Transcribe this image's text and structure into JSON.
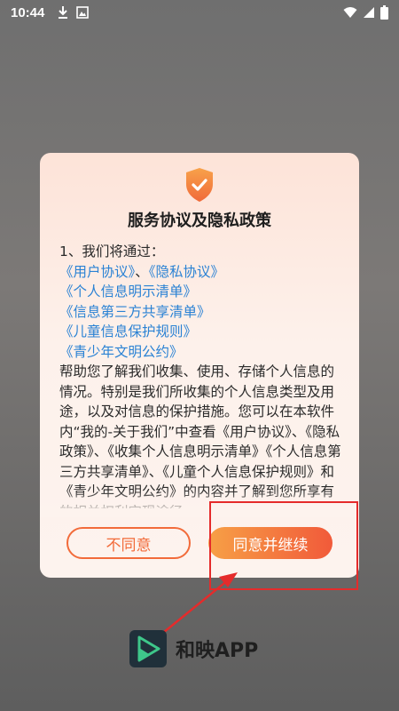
{
  "status_bar": {
    "time": "10:44",
    "left_icons": [
      "download-icon",
      "image-icon"
    ],
    "right_icons": [
      "wifi-icon",
      "signal-icon",
      "battery-icon"
    ]
  },
  "dialog": {
    "title": "服务协议及隐私政策",
    "intro": "1、我们将通过：",
    "links": {
      "user_agreement": "《用户协议》",
      "separator": "、",
      "privacy_agreement": "《隐私协议》",
      "personal_info_list": "《个人信息明示清单》",
      "third_party_list": "《信息第三方共享清单》",
      "child_protection": "《儿童信息保护规则》",
      "youth_pact": "《青少年文明公约》"
    },
    "paragraph": "帮助您了解我们收集、使用、存储个人信息的情况。特别是我们所收集的个人信息类型及用途，以及对信息的保护措施。您可以在本软件内“我的-关于我们”中查看《用户协议》、《隐私政策》、《收集个人信息明示清单》《个人信息第三方共享清单》、《儿童个人信息保护规则》和《青少年文明公约》的内容并了解到您所享有的相关权利实现途径",
    "disagree_label": "不同意",
    "agree_label": "同意并继续"
  },
  "brand": {
    "name": "和映APP"
  },
  "colors": {
    "accent": "#f15a3a",
    "link": "#2a82d4",
    "annotation": "#e52b2b"
  }
}
